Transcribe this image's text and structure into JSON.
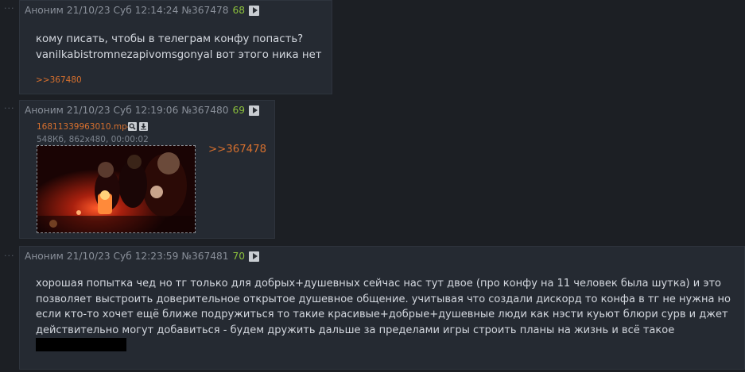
{
  "posts": [
    {
      "author": "Аноним",
      "date": "21/10/23 Суб 12:14:24",
      "number": "№367478",
      "reply_count": "68",
      "text_lines": [
        "кому писать, чтобы в телеграм конфу попасть?",
        "vanilkabistromnezapivomsgonyal вот этого ника нет"
      ],
      "backlink": ">>367480"
    },
    {
      "author": "Аноним",
      "date": "21/10/23 Суб 12:19:06",
      "number": "№367480",
      "reply_count": "69",
      "file": {
        "name": "16811339963010.mp4",
        "meta": "548Кб, 862x480, 00:00:02"
      },
      "quote": ">>367478"
    },
    {
      "author": "Аноним",
      "date": "21/10/23 Суб 12:23:59",
      "number": "№367481",
      "reply_count": "70",
      "text_lines": [
        "хорошая попытка чед но тг только для добрых+душевных сейчас нас тут двое (про конфу на 11 человек была шутка) и это",
        "позволяет выстроить доверительное открытое душевное общение. учитывая что создали дискорд то конфа в тг не нужна но",
        "если кто-то хочет ещё ближе подружиться то такие красивые+добрые+душевные люди как нэсти куьют блюри сурв и джет",
        "действительно могут добавиться - будем дружить дальше за пределами игры строить планы на жизнь и всё такое"
      ]
    }
  ],
  "icons": {
    "play": "play-icon",
    "search": "search-icon",
    "download": "download-icon",
    "dots": "post-menu-icon"
  }
}
